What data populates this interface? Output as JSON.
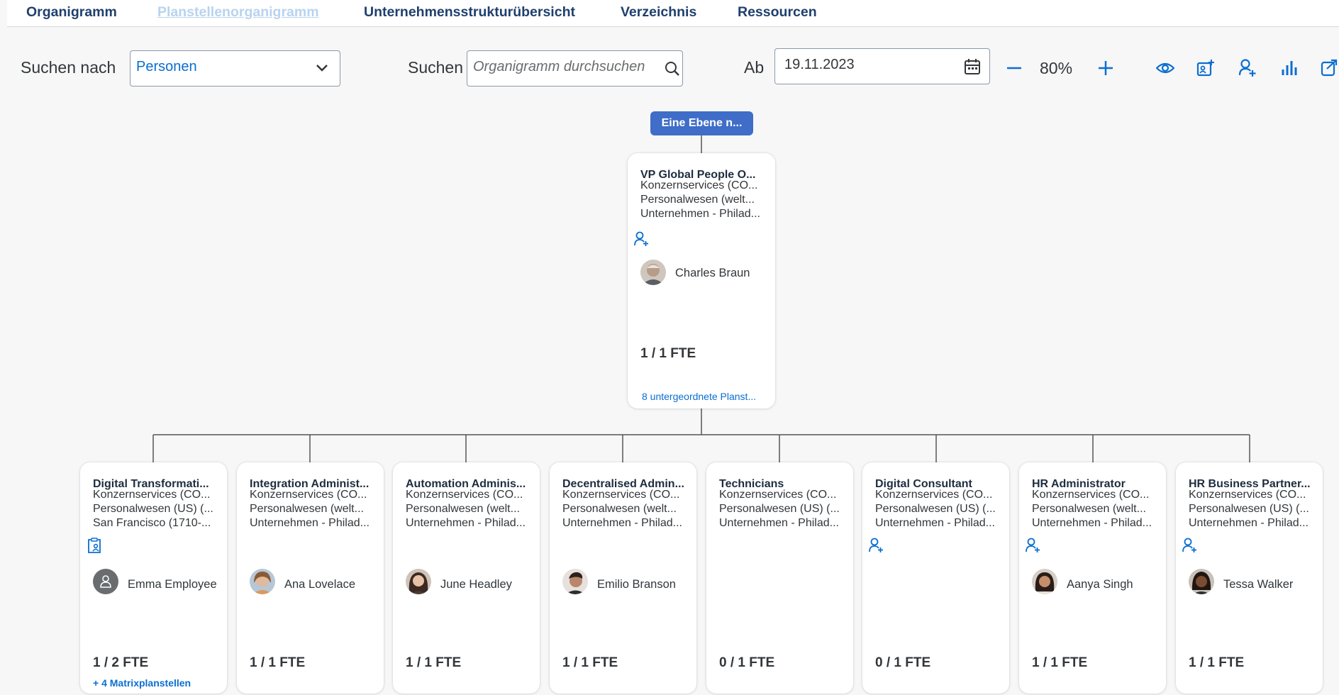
{
  "nav": {
    "tabs": [
      "Organigramm",
      "Planstellenorganigramm",
      "Unternehmensstrukturübersicht",
      "Verzeichnis",
      "Ressourcen"
    ]
  },
  "toolbar": {
    "search_by_label": "Suchen nach",
    "search_by_value": "Personen",
    "search_label": "Suchen",
    "search_placeholder": "Organigramm durchsuchen",
    "date_label": "Ab",
    "date_value": "19.11.2023",
    "zoom": "80%"
  },
  "chart": {
    "up_button": "Eine Ebene n...",
    "root": {
      "title": "VP Global People O...",
      "lines": [
        "Konzernservices (CO...",
        "Personalwesen (welt...",
        "Unternehmen - Philad..."
      ],
      "person": "Charles Braun",
      "fte": "1 / 1 FTE",
      "link": "8 untergeordnete Planst..."
    },
    "children": [
      {
        "title": "Digital Transformati...",
        "lines": [
          "Konzernservices (CO...",
          "Personalwesen (US) (...",
          "San Francisco (1710-..."
        ],
        "icon": "clipboard-person-icon",
        "person": "Emma Employee",
        "avatar": "placeholder",
        "fte": "1 / 2 FTE",
        "link": "+ 4 Matrixplanstellen"
      },
      {
        "title": "Integration Administ...",
        "lines": [
          "Konzernservices (CO...",
          "Personalwesen (welt...",
          "Unternehmen - Philad..."
        ],
        "icon": "",
        "person": "Ana Lovelace",
        "avatar": "photo",
        "fte": "1 / 1 FTE",
        "link": ""
      },
      {
        "title": "Automation Adminis...",
        "lines": [
          "Konzernservices (CO...",
          "Personalwesen (welt...",
          "Unternehmen - Philad..."
        ],
        "icon": "",
        "person": "June Headley",
        "avatar": "photo",
        "fte": "1 / 1 FTE",
        "link": ""
      },
      {
        "title": "Decentralised Admin...",
        "lines": [
          "Konzernservices (CO...",
          "Personalwesen (welt...",
          "Unternehmen - Philad..."
        ],
        "icon": "",
        "person": "Emilio Branson",
        "avatar": "photo",
        "fte": "1 / 1 FTE",
        "link": ""
      },
      {
        "title": "Technicians",
        "lines": [
          "Konzernservices (CO...",
          "Personalwesen (US) (...",
          "Unternehmen - Philad..."
        ],
        "icon": "",
        "person": "",
        "avatar": "",
        "fte": "0 / 1 FTE",
        "link": ""
      },
      {
        "title": "Digital Consultant",
        "lines": [
          "Konzernservices (CO...",
          "Personalwesen (US) (...",
          "Unternehmen - Philad..."
        ],
        "icon": "add-person-icon",
        "person": "",
        "avatar": "",
        "fte": "0 / 1 FTE",
        "link": ""
      },
      {
        "title": "HR Administrator",
        "lines": [
          "Konzernservices (CO...",
          "Personalwesen (welt...",
          "Unternehmen - Philad..."
        ],
        "icon": "add-person-icon",
        "person": "Aanya Singh",
        "avatar": "photo",
        "fte": "1 / 1 FTE",
        "link": ""
      },
      {
        "title": "HR Business Partner...",
        "lines": [
          "Konzernservices (CO...",
          "Personalwesen (US) (...",
          "Unternehmen - Philad..."
        ],
        "icon": "add-person-icon",
        "person": "Tessa Walker",
        "avatar": "photo",
        "fte": "1 / 1 FTE",
        "link": ""
      }
    ]
  },
  "colors": {
    "accent": "#0a6ed1",
    "nav_text": "#1f3f6e",
    "up_button": "#3f6dc7"
  }
}
